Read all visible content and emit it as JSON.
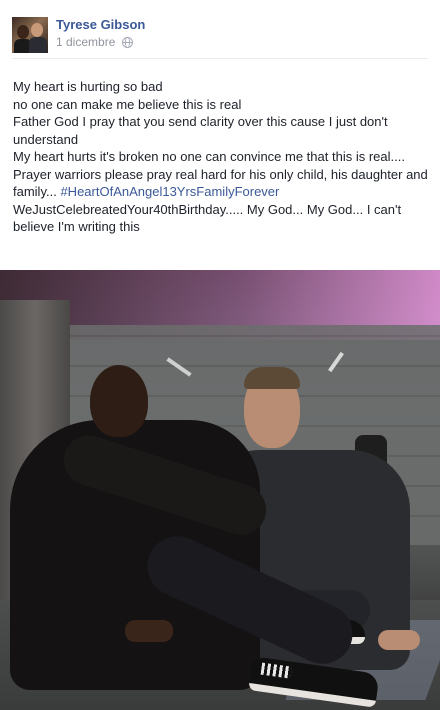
{
  "post": {
    "author": "Tyrese Gibson",
    "date": "1 dicembre",
    "privacy_icon": "globe-icon",
    "lines": [
      "My heart is hurting so bad",
      "no one can make me believe this is real",
      "Father God I pray that you send clarity over this cause I just don't understand",
      "My heart hurts it's broken no one can convince me that this is real.... Prayer warriors please pray real hard for his only child, his daughter and family..."
    ],
    "hashtag": "#HeartOfAnAngel13YrsFamilyForever",
    "line_after_hashtag": "WeJustCelebreatedYour40thBirthday..... My God... My God... I can't believe I'm writing this"
  },
  "colors": {
    "link": "#3b5998",
    "text": "#1d2129",
    "meta": "#90949c"
  }
}
